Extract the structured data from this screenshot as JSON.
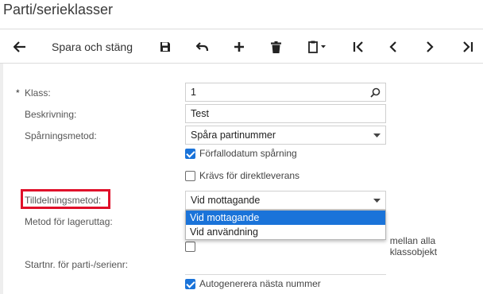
{
  "page": {
    "title": "Parti/serieklasser"
  },
  "toolbar": {
    "back_icon": "arrow-left-icon",
    "save_close_label": "Spara och stäng",
    "save_icon": "floppy-disk-icon",
    "undo_icon": "undo-icon",
    "add_icon": "plus-icon",
    "delete_icon": "trash-icon",
    "copy_paste_icon": "clipboard-icon",
    "first_icon": "first-record-icon",
    "prev_icon": "chevron-left-icon",
    "next_icon": "chevron-right-icon",
    "last_icon": "last-record-icon"
  },
  "form": {
    "required_mark": "*",
    "klass": {
      "label": "Klass:",
      "value": "1"
    },
    "beskrivning": {
      "label": "Beskrivning:",
      "value": "Test"
    },
    "sparningsmetod": {
      "label": "Spårningsmetod:",
      "value": "Spåra partinummer"
    },
    "forfallodatum": {
      "label": "Förfallodatum spårning",
      "checked": true
    },
    "direktleverans": {
      "label": "Krävs för direktleverans",
      "checked": false
    },
    "tilldelningsmetod": {
      "label": "Tilldelningsmetod:",
      "value": "Vid mottagande",
      "options": [
        "Vid mottagande",
        "Vid användning"
      ]
    },
    "lageruttag": {
      "label": "Metod för lageruttag:"
    },
    "dela_startnr": {
      "label_visible_part": "mellan alla klassobjekt"
    },
    "startnr": {
      "label": "Startnr. för parti-/serienr:"
    },
    "autogenerera": {
      "label": "Autogenerera nästa nummer",
      "checked": true
    }
  },
  "colors": {
    "accent": "#1a73d9",
    "highlight_border": "#e0102a"
  }
}
